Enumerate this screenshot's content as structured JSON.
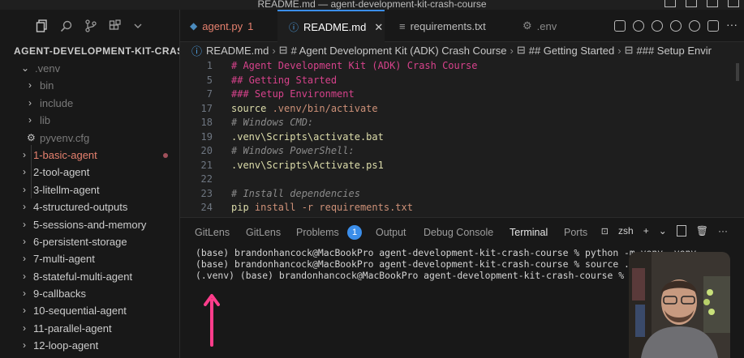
{
  "window": {
    "title": "README.md — agent-development-kit-crash-course"
  },
  "sidebar": {
    "title": "AGENT-DEVELOPMENT-KIT-CRASH...",
    "items": [
      {
        "label": ".venv",
        "state": "expanded"
      },
      {
        "label": "bin",
        "state": "collapsed"
      },
      {
        "label": "include",
        "state": "collapsed"
      },
      {
        "label": "lib",
        "state": "collapsed"
      },
      {
        "label": "pyvenv.cfg",
        "state": "file"
      },
      {
        "label": "1-basic-agent",
        "state": "collapsed"
      },
      {
        "label": "2-tool-agent",
        "state": "collapsed"
      },
      {
        "label": "3-litellm-agent",
        "state": "collapsed"
      },
      {
        "label": "4-structured-outputs",
        "state": "collapsed"
      },
      {
        "label": "5-sessions-and-memory",
        "state": "collapsed"
      },
      {
        "label": "6-persistent-storage",
        "state": "collapsed"
      },
      {
        "label": "7-multi-agent",
        "state": "collapsed"
      },
      {
        "label": "8-stateful-multi-agent",
        "state": "collapsed"
      },
      {
        "label": "9-callbacks",
        "state": "collapsed"
      },
      {
        "label": "10-sequential-agent",
        "state": "collapsed"
      },
      {
        "label": "11-parallel-agent",
        "state": "collapsed"
      },
      {
        "label": "12-loop-agent",
        "state": "collapsed"
      }
    ]
  },
  "tabs": [
    {
      "label": "agent.py",
      "badge": "1"
    },
    {
      "label": "README.md",
      "active": true
    },
    {
      "label": "requirements.txt"
    },
    {
      "label": ".env"
    }
  ],
  "breadcrumb": [
    "README.md",
    "# Agent Development Kit (ADK) Crash Course",
    "## Getting Started",
    "### Setup Envir"
  ],
  "editor": {
    "lines": [
      {
        "num": "1",
        "text": "# Agent Development Kit (ADK) Crash Course"
      },
      {
        "num": "5",
        "text": "## Getting Started"
      },
      {
        "num": "7",
        "text": "### Setup Environment"
      },
      {
        "num": "17",
        "kw": "source",
        "arg": " .venv/bin/activate"
      },
      {
        "num": "18",
        "text": "# Windows CMD:"
      },
      {
        "num": "19",
        "text": ".venv\\Scripts\\activate.bat"
      },
      {
        "num": "20",
        "text": "# Windows PowerShell:"
      },
      {
        "num": "21",
        "text": ".venv\\Scripts\\Activate.ps1"
      },
      {
        "num": "22",
        "text": ""
      },
      {
        "num": "23",
        "text": "# Install dependencies"
      },
      {
        "num": "24",
        "kw": "pip",
        "arg": " install -r requirements.txt"
      }
    ]
  },
  "panel": {
    "tabs": [
      "GitLens",
      "GitLens",
      "Problems",
      "Output",
      "Debug Console",
      "Terminal",
      "Ports"
    ],
    "problems_count": "1",
    "shell": "zsh",
    "terminal_lines": [
      "(base) brandonhancock@MacBookPro agent-development-kit-crash-course % python -m venv .venv",
      "(base) brandonhancock@MacBookPro agent-development-kit-crash-course % source .venv/bin/activate",
      "(.venv) (base) brandonhancock@MacBookPro agent-development-kit-crash-course % "
    ]
  },
  "colors": {
    "accent": "#3b8eea",
    "arrow": "#ff3d8b",
    "heading": "#d6428b",
    "modified": "#e5806e"
  }
}
